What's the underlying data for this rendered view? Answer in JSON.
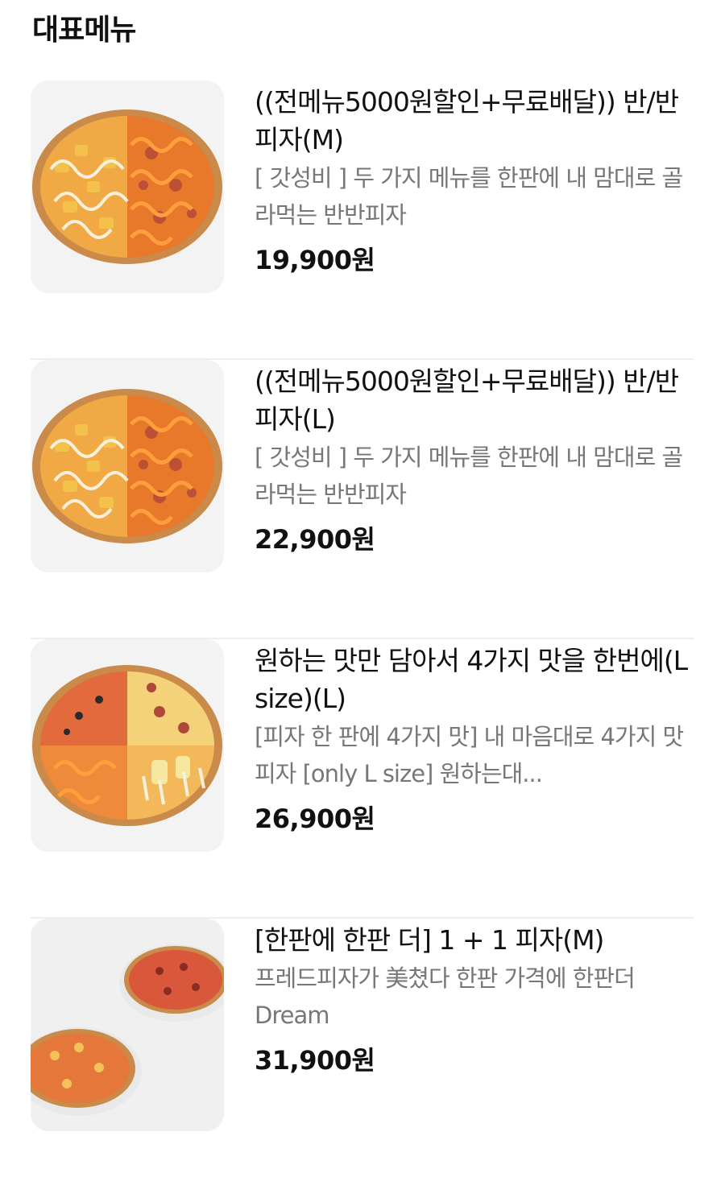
{
  "section": {
    "title": "대표메뉴"
  },
  "menu": [
    {
      "name": "((전메뉴5000원할인+무료배달)) 반/반 피자(M)",
      "desc": "[ 갓성비 ] 두 가지 메뉴를 한판에 내 맘대로 골라먹는 반반피자",
      "price": "19,900원",
      "image_icon": "half-half-pizza-image"
    },
    {
      "name": "((전메뉴5000원할인+무료배달)) 반/반 피자(L)",
      "desc": "[ 갓성비 ] 두 가지 메뉴를 한판에 내 맘대로 골라먹는 반반피자",
      "price": "22,900원",
      "image_icon": "half-half-pizza-image"
    },
    {
      "name": "원하는 맛만 담아서 4가지 맛을 한번에(L size)(L)",
      "desc": "[피자 한 판에 4가지 맛] 내 마음대로 4가지 맛 피자 [only L size] 원하는대...",
      "price": "26,900원",
      "image_icon": "quarter-pizza-image"
    },
    {
      "name": "[한판에 한판 더] 1 + 1 피자(M)",
      "desc": "프레드피자가 美쳤다 한판 가격에 한판더 Dream",
      "price": "31,900원",
      "image_icon": "two-pizzas-image"
    }
  ],
  "colors": {
    "crust": "#c98a4a",
    "sauce": "#e8782a",
    "cheese": "#f4c24a",
    "mayo": "#f7f1dc"
  }
}
